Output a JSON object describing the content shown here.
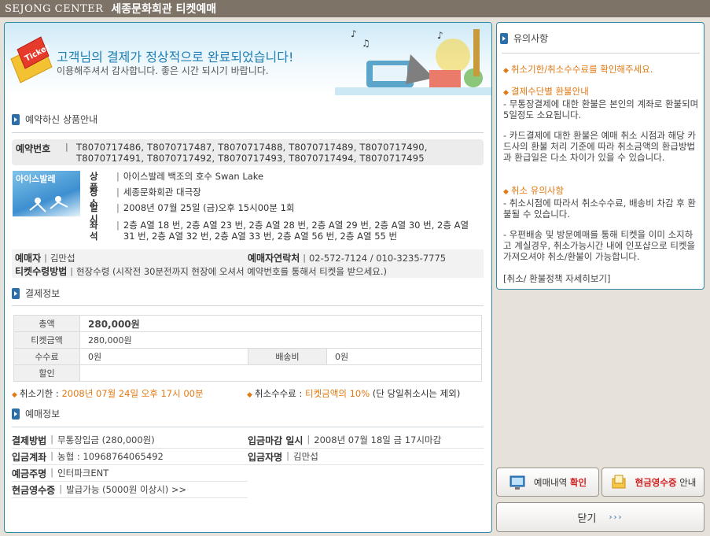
{
  "header": {
    "brand": "SEJONG CENTER",
    "title": "세종문화회관 티켓예매"
  },
  "banner": {
    "ticket_label": "Ticket",
    "message": "고객님의 결제가 정상적으로 완료되었습니다!",
    "sub_message": "이용해주셔서 감사합니다. 좋은 시간 되시기 바랍니다."
  },
  "product": {
    "section_title": "예약하신 상품안내",
    "reservation_label": "예약번호",
    "reservation_numbers_line1": "T8070717486, T8070717487, T8070717488, T8070717489, T8070717490,",
    "reservation_numbers_line2": "T8070717491, T8070717492, T8070717493, T8070717494, T8070717495",
    "poster_text": "아이스발레",
    "rows": [
      {
        "label": "상 품",
        "value": "아이스발레 백조의 호수 Swan Lake"
      },
      {
        "label": "장 소",
        "value": "세종문화회관 대극장"
      },
      {
        "label": "일 시",
        "value": "2008년 07월 25일 (금)오후 15시00분 1회"
      },
      {
        "label": "좌 석",
        "value": "2층 A열 18 번, 2층 A열 23 번, 2층 A열 28 번, 2층 A열 29 번, 2층 A열 30 번, 2층 A열 31 번, 2층 A열 32 번, 2층 A열 33 번, 2층 A열 56 번, 2층 A열 55 번"
      }
    ],
    "buyer_label": "예매자",
    "buyer_value": "김만섭",
    "contact_label": "예매자연락처",
    "contact_value": "02-572-7124 / 010-3235-7775",
    "receive_label": "티켓수령방법",
    "receive_value": "현장수령 (시작전 30분전까지 현장에 오셔서 예약번호를 통해서 티켓을 받으세요.)"
  },
  "payment": {
    "section_title": "결제정보",
    "total_label": "총액",
    "total_value": "280,000원",
    "ticket_label": "티켓금액",
    "ticket_value": "280,000원",
    "fee_label": "수수료",
    "fee_value": "0원",
    "delivery_label": "배송비",
    "delivery_value": "0원",
    "discount_label": "할인",
    "discount_value": "",
    "deadline_label": "취소기한 :",
    "deadline_value": "2008년 07월 24일 오후 17시 00분",
    "cancel_fee_label": "취소수수료 :",
    "cancel_fee_value": "티켓금액의 10%",
    "cancel_fee_note": "(단 당일취소시는 제외)"
  },
  "booking": {
    "section_title": "예매정보",
    "method_label": "결제방법",
    "method_value": "무통장입금 (280,000원)",
    "due_label": "입금마감 일시",
    "due_value": "2008년 07월 18일 금 17시마감",
    "account_label": "입금계좌",
    "account_value": "농협 : 10968764065492",
    "depositor_label": "입금자명",
    "depositor_value": "김만섭",
    "holder_label": "예금주명",
    "holder_value": "인터파크ENT",
    "receipt_label": "현금영수증",
    "receipt_value": "발급가능 (5000원 이상시) >>"
  },
  "notice": {
    "title": "유의사항",
    "check": "취소기한/취소수수료를 확인해주세요.",
    "refund_title": "결제수단별 환불안내",
    "refund_text1": "- 무통장결제에 대한 환불은 본인의 계좌로 환불되며 5일정도 소요됩니다.",
    "refund_text2": "- 카드결제에 대한 환불은 예매 취소 시점과 해당 카드사의 환불 처리 기준에 따라 취소금액의 환급방법과 환급일은 다소 차이가 있을 수 있습니다.",
    "cancel_title": "취소 유의사항",
    "cancel_text1": "- 취소시점에 따라서 취소수수료, 배송비 차감 후 환불될 수 있습니다.",
    "cancel_text2": "- 우편배송 및 방문예매를 통해 티켓을 이미 소지하고 계실경우, 취소가능시간 내에 인포샵으로 티켓을 가져오셔야 취소/환불이 가능합니다.",
    "policy_link": "[취소/ 환불정책 자세히보기]"
  },
  "buttons": {
    "history_prefix": "예매내역",
    "history_emph": "확인",
    "receipt_emph": "현금영수증",
    "receipt_suffix": "안내",
    "close": "닫기",
    "close_arrows": "›››"
  }
}
